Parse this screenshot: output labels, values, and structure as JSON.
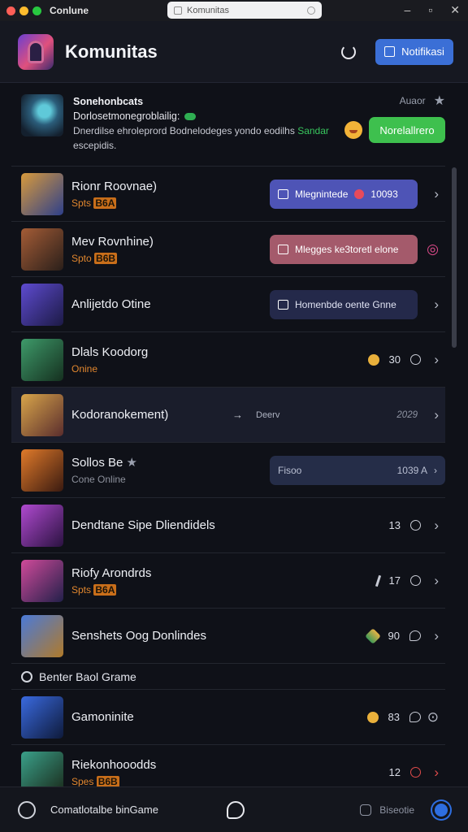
{
  "titlebar": {
    "app_name": "Conlune",
    "url": "Komunitas"
  },
  "header": {
    "title": "Komunitas",
    "button_label": "Notifikasi"
  },
  "featured": {
    "title": "Sonehonbcats",
    "subtitle": "Dorlosetmonegroblailig:",
    "desc": "Dnerdilse ehroleprord Bodnelodeges yondo eodilhs",
    "desc_link": "Sandar",
    "desc2": "escepidis.",
    "time": "Auaor",
    "join_label": "Norelallrero"
  },
  "rows": [
    {
      "name": "Rionr Roovnae)",
      "sub_prefix": "Spts",
      "sub_badge": "B6A",
      "pill": "Mlegnintede",
      "pill_num": "10093",
      "colors": [
        "#d89a3c",
        "#2d3f8a"
      ]
    },
    {
      "name": "Mev Rovnhine)",
      "sub_prefix": "Spto",
      "sub_badge": "B6B",
      "pill": "Mlegges ke3toretl elone",
      "colors": [
        "#a45c36",
        "#2a1f1a"
      ]
    },
    {
      "name": "Anlijetdo Otine",
      "pill": "Homenbde oente Gnne",
      "colors": [
        "#5e4bd0",
        "#1c1a45"
      ]
    },
    {
      "name": "Dlals Koodorg",
      "sub": "Onine",
      "count": "30",
      "colors": [
        "#3e9a6a",
        "#15301f"
      ]
    },
    {
      "name": "Kodoranokement)",
      "mid": "Deerv",
      "time": "2029",
      "colors": [
        "#d8a54a",
        "#5a2d2d"
      ]
    },
    {
      "name": "Sollos Be",
      "sub": "Cone Online",
      "pill": "Fisoo",
      "pill_time": "1039 A",
      "colors": [
        "#e07a2a",
        "#3a1a10"
      ]
    },
    {
      "name": "Dendtane Sipe Dliendidels",
      "count": "13",
      "colors": [
        "#b04ad0",
        "#2a1240"
      ]
    },
    {
      "name": "Riofy Arondrds",
      "sub_prefix": "Spts",
      "sub_badge": "B6A",
      "count": "17",
      "colors": [
        "#d04a9a",
        "#22204a"
      ]
    },
    {
      "name": "Senshets Oog Donlindes",
      "count": "90",
      "colors": [
        "#4a7ad8",
        "#b07a2a"
      ]
    }
  ],
  "section": {
    "title": "Benter Baol Grame"
  },
  "rows2": [
    {
      "name": "Gamoninite",
      "count": "83",
      "colors": [
        "#3a6ae0",
        "#0e1a3a"
      ]
    },
    {
      "name": "Riekonhooodds",
      "sub_prefix": "Spes",
      "sub_badge": "B6B",
      "count": "12",
      "colors": [
        "#3aa08a",
        "#1a2a1a"
      ]
    }
  ],
  "bottom": {
    "label": "Comatlotalbe binGame",
    "right_label": "Biseotie"
  }
}
